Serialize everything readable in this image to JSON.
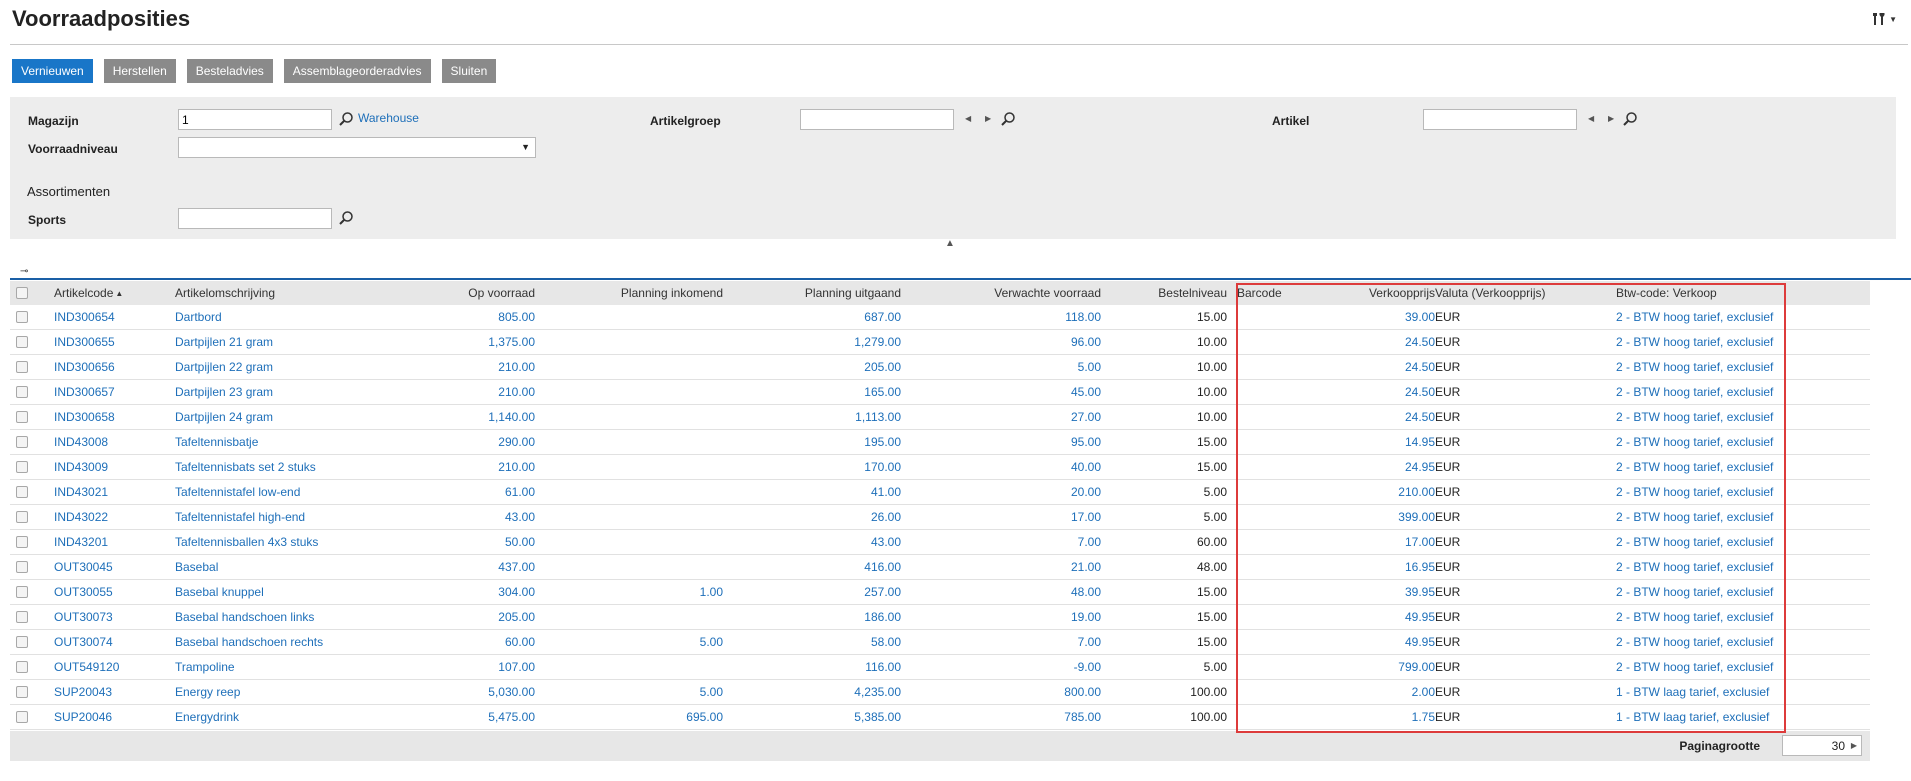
{
  "page": {
    "title": "Voorraadposities"
  },
  "toolbar": {
    "buttons": [
      "Vernieuwen",
      "Herstellen",
      "Besteladvies",
      "Assemblageorderadvies",
      "Sluiten"
    ]
  },
  "filters": {
    "magazijn_label": "Magazijn",
    "magazijn_value": "1",
    "magazijn_link": "Warehouse",
    "artikelgroep_label": "Artikelgroep",
    "artikelgroep_value": "",
    "artikel_label": "Artikel",
    "artikel_value": "",
    "voorraadniveau_label": "Voorraadniveau",
    "voorraadniveau_value": "",
    "assortimenten_heading": "Assortimenten",
    "sports_label": "Sports",
    "sports_value": ""
  },
  "table": {
    "headers": [
      "Artikelcode",
      "Artikelomschrijving",
      "Op voorraad",
      "Planning inkomend",
      "Planning uitgaand",
      "Verwachte voorraad",
      "Bestelniveau",
      "Barcode",
      "Verkoopprijs",
      "Valuta (Verkoopprijs)",
      "Btw-code: Verkoop"
    ],
    "sort_column": "Artikelcode",
    "rows": [
      [
        "IND300654",
        "Dartbord",
        "805.00",
        "",
        "687.00",
        "118.00",
        "15.00",
        "",
        "39.00",
        "EUR",
        "2 - BTW hoog tarief, exclusief"
      ],
      [
        "IND300655",
        "Dartpijlen 21 gram",
        "1,375.00",
        "",
        "1,279.00",
        "96.00",
        "10.00",
        "",
        "24.50",
        "EUR",
        "2 - BTW hoog tarief, exclusief"
      ],
      [
        "IND300656",
        "Dartpijlen 22 gram",
        "210.00",
        "",
        "205.00",
        "5.00",
        "10.00",
        "",
        "24.50",
        "EUR",
        "2 - BTW hoog tarief, exclusief"
      ],
      [
        "IND300657",
        "Dartpijlen 23 gram",
        "210.00",
        "",
        "165.00",
        "45.00",
        "10.00",
        "",
        "24.50",
        "EUR",
        "2 - BTW hoog tarief, exclusief"
      ],
      [
        "IND300658",
        "Dartpijlen 24 gram",
        "1,140.00",
        "",
        "1,113.00",
        "27.00",
        "10.00",
        "",
        "24.50",
        "EUR",
        "2 - BTW hoog tarief, exclusief"
      ],
      [
        "IND43008",
        "Tafeltennisbatje",
        "290.00",
        "",
        "195.00",
        "95.00",
        "15.00",
        "",
        "14.95",
        "EUR",
        "2 - BTW hoog tarief, exclusief"
      ],
      [
        "IND43009",
        "Tafeltennisbats set 2 stuks",
        "210.00",
        "",
        "170.00",
        "40.00",
        "15.00",
        "",
        "24.95",
        "EUR",
        "2 - BTW hoog tarief, exclusief"
      ],
      [
        "IND43021",
        "Tafeltennistafel low-end",
        "61.00",
        "",
        "41.00",
        "20.00",
        "5.00",
        "",
        "210.00",
        "EUR",
        "2 - BTW hoog tarief, exclusief"
      ],
      [
        "IND43022",
        "Tafeltennistafel high-end",
        "43.00",
        "",
        "26.00",
        "17.00",
        "5.00",
        "",
        "399.00",
        "EUR",
        "2 - BTW hoog tarief, exclusief"
      ],
      [
        "IND43201",
        "Tafeltennisballen 4x3 stuks",
        "50.00",
        "",
        "43.00",
        "7.00",
        "60.00",
        "",
        "17.00",
        "EUR",
        "2 - BTW hoog tarief, exclusief"
      ],
      [
        "OUT30045",
        "Basebal",
        "437.00",
        "",
        "416.00",
        "21.00",
        "48.00",
        "",
        "16.95",
        "EUR",
        "2 - BTW hoog tarief, exclusief"
      ],
      [
        "OUT30055",
        "Basebal knuppel",
        "304.00",
        "1.00",
        "257.00",
        "48.00",
        "15.00",
        "",
        "39.95",
        "EUR",
        "2 - BTW hoog tarief, exclusief"
      ],
      [
        "OUT30073",
        "Basebal handschoen links",
        "205.00",
        "",
        "186.00",
        "19.00",
        "15.00",
        "",
        "49.95",
        "EUR",
        "2 - BTW hoog tarief, exclusief"
      ],
      [
        "OUT30074",
        "Basebal handschoen rechts",
        "60.00",
        "5.00",
        "58.00",
        "7.00",
        "15.00",
        "",
        "49.95",
        "EUR",
        "2 - BTW hoog tarief, exclusief"
      ],
      [
        "OUT549120",
        "Trampoline",
        "107.00",
        "",
        "116.00",
        "-9.00",
        "5.00",
        "",
        "799.00",
        "EUR",
        "2 - BTW hoog tarief, exclusief"
      ],
      [
        "SUP20043",
        "Energy reep",
        "5,030.00",
        "5.00",
        "4,235.00",
        "800.00",
        "100.00",
        "",
        "2.00",
        "EUR",
        "1 - BTW laag tarief, exclusief"
      ],
      [
        "SUP20046",
        "Energydrink",
        "5,475.00",
        "695.00",
        "5,385.00",
        "785.00",
        "100.00",
        "",
        "1.75",
        "EUR",
        "1 - BTW laag tarief, exclusief"
      ]
    ]
  },
  "footer": {
    "page_size_label": "Paginagrootte",
    "page_size_value": "30"
  },
  "colors": {
    "primary": "#1976c8",
    "link": "#1e6fb9",
    "highlight": "#dd3b3b"
  }
}
